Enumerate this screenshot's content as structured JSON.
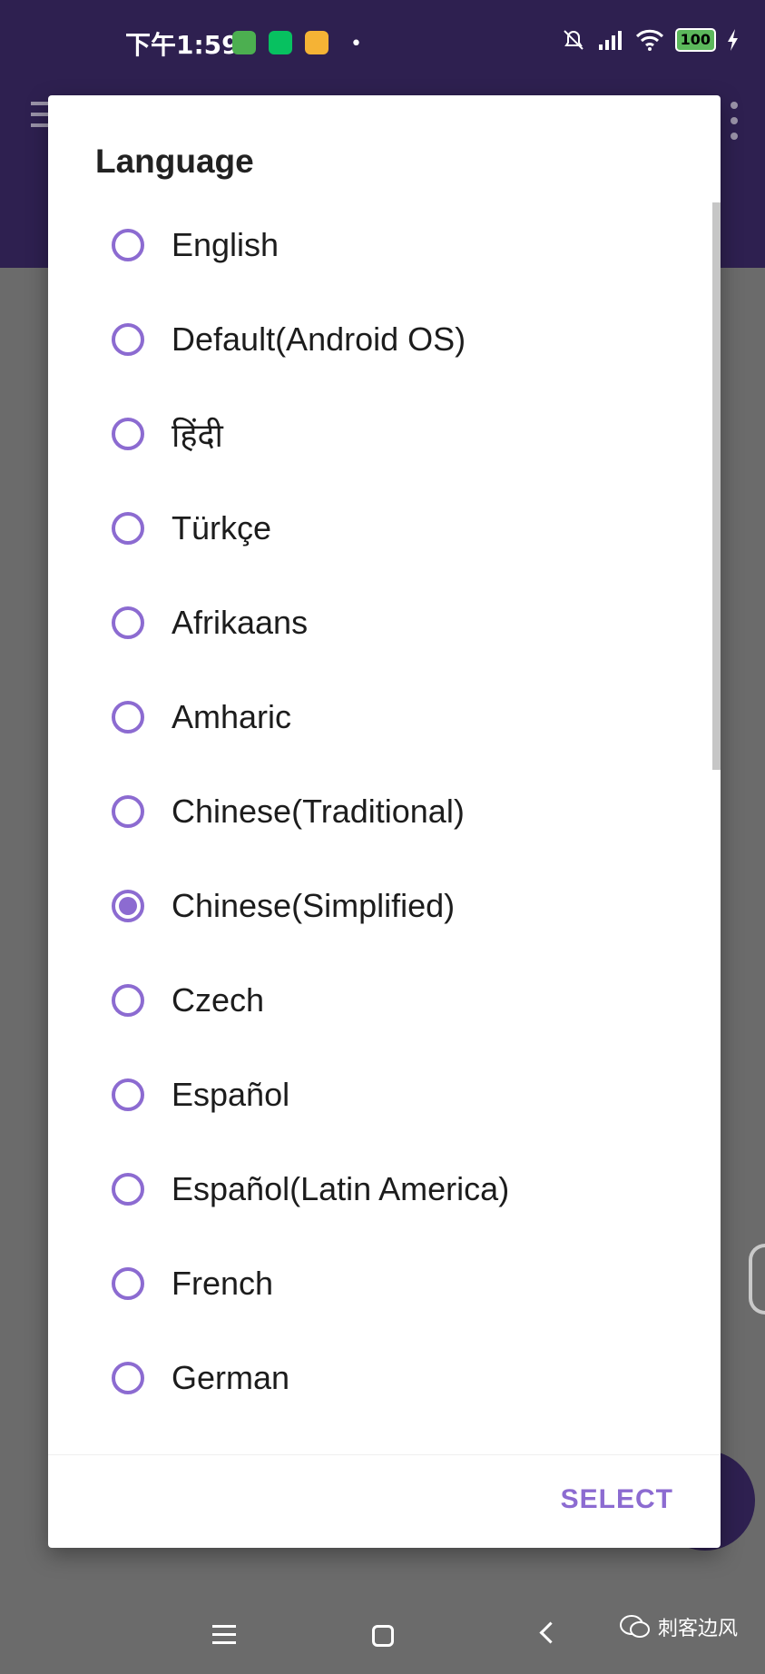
{
  "status_bar": {
    "time": "下午1:59",
    "battery": "100",
    "dot": "•"
  },
  "dialog": {
    "title": "Language",
    "options": [
      {
        "label": "English",
        "selected": false
      },
      {
        "label": "Default(Android OS)",
        "selected": false
      },
      {
        "label": "हिंदी",
        "selected": false
      },
      {
        "label": "Türkçe",
        "selected": false
      },
      {
        "label": "Afrikaans",
        "selected": false
      },
      {
        "label": "Amharic",
        "selected": false
      },
      {
        "label": "Chinese(Traditional)",
        "selected": false
      },
      {
        "label": "Chinese(Simplified)",
        "selected": true
      },
      {
        "label": "Czech",
        "selected": false
      },
      {
        "label": "Español",
        "selected": false
      },
      {
        "label": "Español(Latin America)",
        "selected": false
      },
      {
        "label": "French",
        "selected": false
      },
      {
        "label": "German",
        "selected": false
      }
    ],
    "select_label": "SELECT"
  },
  "watermark": {
    "text": "刺客边风"
  },
  "colors": {
    "accent": "#8c6bd1",
    "app_bar": "#2e2050",
    "scrim": "#6b6b6b"
  }
}
